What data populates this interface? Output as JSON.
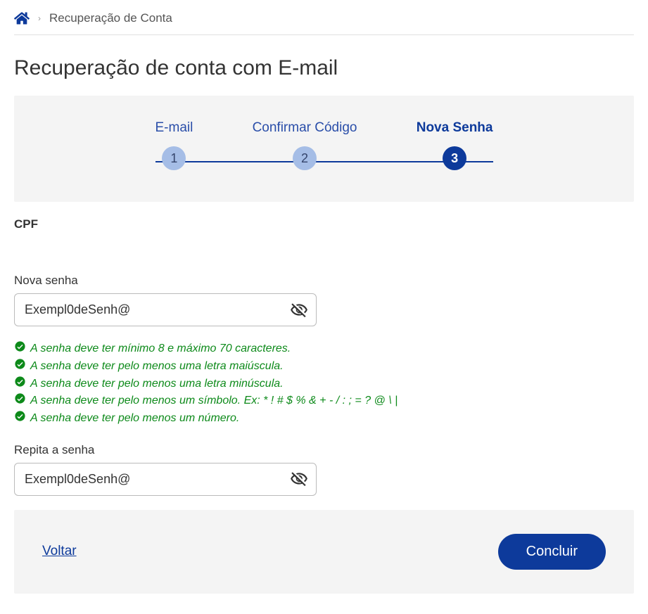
{
  "breadcrumb": {
    "page_label": "Recuperação de Conta"
  },
  "title": "Recuperação de conta com E-mail",
  "stepper": {
    "steps": [
      {
        "label": "E-mail",
        "number": "1",
        "active": false
      },
      {
        "label": "Confirmar Código",
        "number": "2",
        "active": false
      },
      {
        "label": "Nova Senha",
        "number": "3",
        "active": true
      }
    ]
  },
  "fields": {
    "cpf_label": "CPF",
    "new_password_label": "Nova senha",
    "new_password_value": "Exempl0deSenh@",
    "repeat_password_label": "Repita a senha",
    "repeat_password_value": "Exempl0deSenh@"
  },
  "validation_rules": [
    "A senha deve ter mínimo 8 e máximo 70 caracteres.",
    "A senha deve ter pelo menos uma letra maiúscula.",
    "A senha deve ter pelo menos uma letra minúscula.",
    "A senha deve ter pelo menos um símbolo. Ex: * ! # $ % & + - / : ; = ? @ \\ |",
    "A senha deve ter pelo menos um número."
  ],
  "footer": {
    "back_label": "Voltar",
    "submit_label": "Concluir"
  },
  "colors": {
    "primary": "#0d3a9b",
    "success": "#0d8a1a"
  }
}
